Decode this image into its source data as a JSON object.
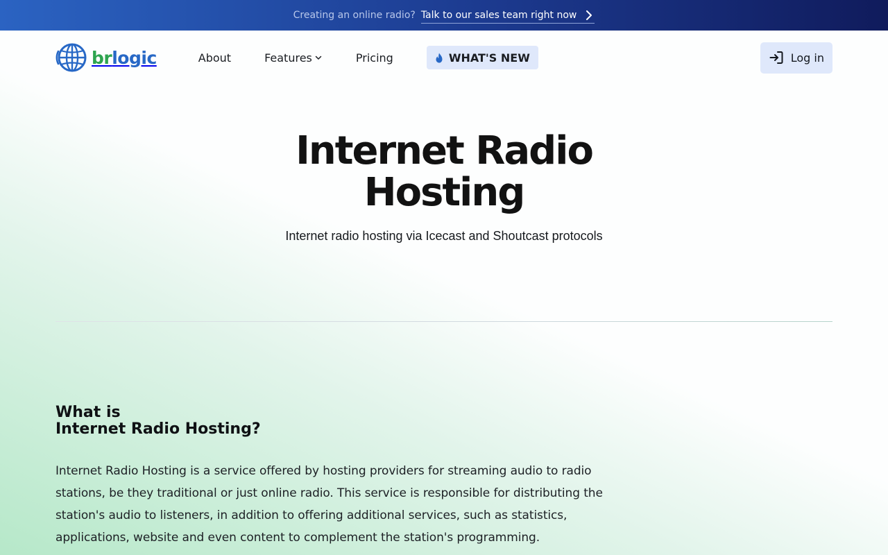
{
  "announcement": {
    "question": "Creating an online radio?",
    "cta_label": "Talk to our sales team right now"
  },
  "nav": {
    "logo": {
      "part_a": "br",
      "part_b": "logic"
    },
    "items": [
      {
        "label": "About"
      },
      {
        "label": "Features"
      },
      {
        "label": "Pricing"
      }
    ],
    "whats_new_label": "WHAT'S NEW",
    "login_label": "Log in"
  },
  "hero": {
    "title_line1": "Internet Radio",
    "title_line2": "Hosting",
    "subtitle": "Internet radio hosting via Icecast and Shoutcast protocols"
  },
  "about": {
    "heading_line1": "What is",
    "heading_line2": "Internet Radio Hosting?",
    "body": "Internet Radio Hosting is a service offered by hosting providers for streaming audio to radio stations, be they traditional or just online radio. This service is responsible for distributing the station's audio to listeners, in addition to offering additional services, such as statistics, applications, website and even content to complement the station's programming."
  },
  "colors": {
    "accent_blue": "#2768c6",
    "accent_green": "#2ea44f",
    "banner_start": "#2b63c2",
    "banner_end": "#101b5c",
    "pill_bg": "#dfe8fb"
  },
  "icons": {
    "banner": "chevron-right-icon",
    "logo": "globe-icon",
    "features": "chevron-down-icon",
    "whats_new": "flame-icon",
    "login": "login-icon"
  }
}
